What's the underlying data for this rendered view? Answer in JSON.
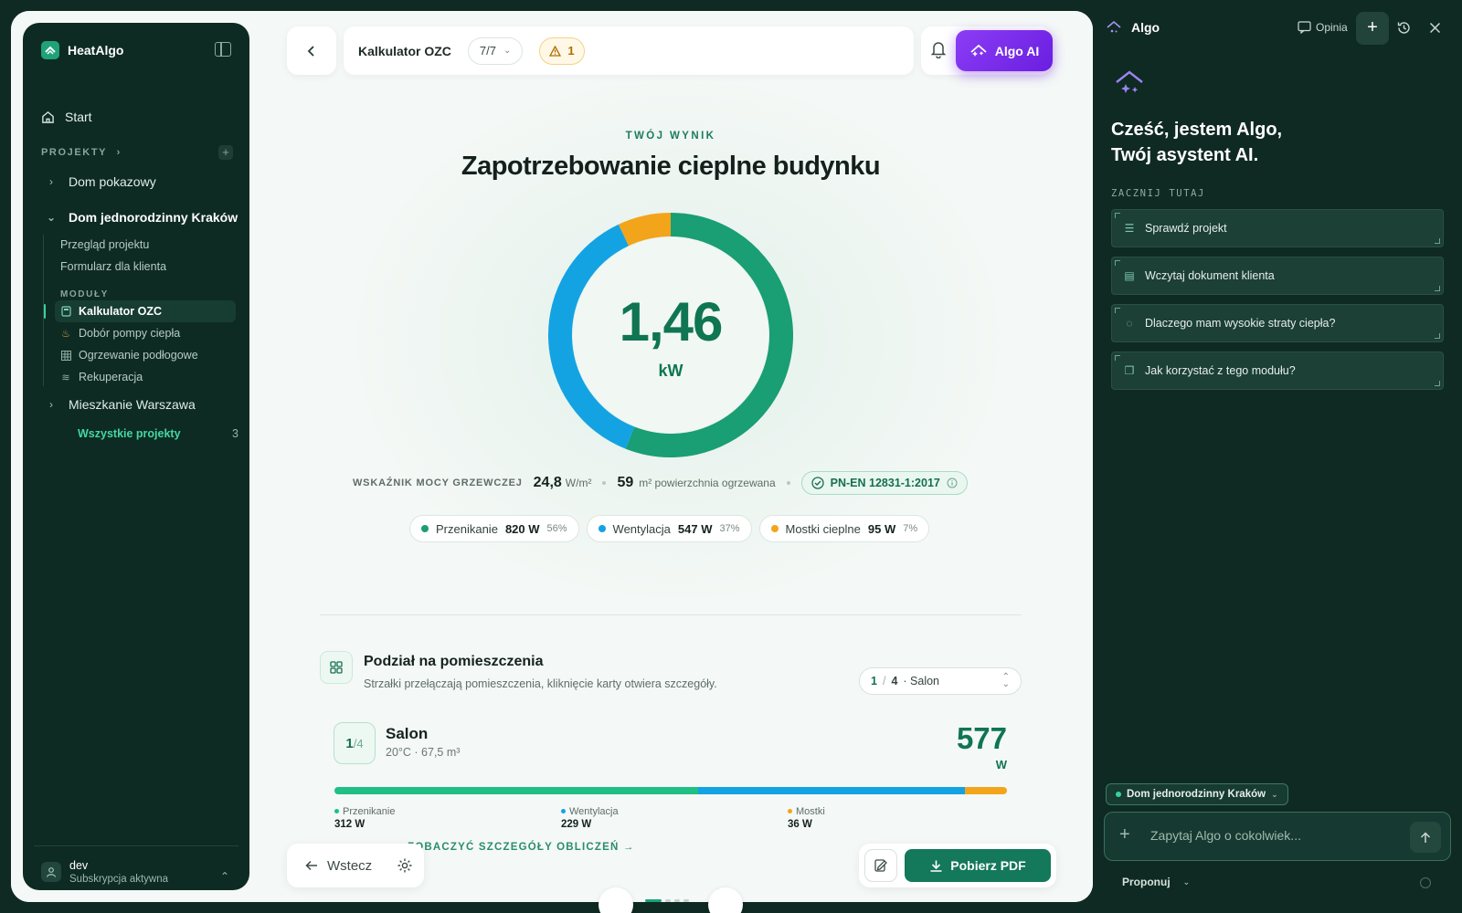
{
  "colors": {
    "primary_green": "#1a9e74",
    "blue": "#13a3e3",
    "orange": "#f2a51a",
    "dark_sidebar": "#0d2b23",
    "accent_purple": "#7b2ff0"
  },
  "sidebar": {
    "app_name": "HeatAlgo",
    "start_label": "Start",
    "projects_label": "PROJEKTY",
    "projects": [
      {
        "name": "Dom pokazowy",
        "expanded": false
      },
      {
        "name": "Dom jednorodzinny Kraków",
        "expanded": true
      },
      {
        "name": "Mieszkanie Warszawa",
        "expanded": false
      }
    ],
    "sub_items": [
      "Przegląd projektu",
      "Formularz dla klienta"
    ],
    "modules_label": "MODUŁY",
    "modules": [
      {
        "label": "Kalkulator OZC",
        "icon": "calculator-icon",
        "active": true
      },
      {
        "label": "Dobór pompy ciepła",
        "icon": "flame-icon",
        "active": false
      },
      {
        "label": "Ogrzewanie podłogowe",
        "icon": "grid-icon",
        "active": false
      },
      {
        "label": "Rekuperacja",
        "icon": "wind-icon",
        "active": false
      }
    ],
    "all_projects_label": "Wszystkie projekty",
    "all_projects_count": "3",
    "user_name": "dev",
    "user_status": "Subskrypcja aktywna"
  },
  "topbar": {
    "title": "Kalkulator OZC",
    "step": "7/7",
    "warnings": "1",
    "ai_button": "Algo AI"
  },
  "result": {
    "eyebrow": "TWÓJ WYNIK",
    "title": "Zapotrzebowanie cieplne budynku",
    "value": "1,46",
    "unit": "kW",
    "indicator_label": "WSKAŹNIK MOCY GRZEWCZEJ",
    "indicator_value": "24,8",
    "indicator_unit": "W/m²",
    "area_value": "59",
    "area_label": "m² powierzchnia ogrzewana",
    "norm": "PN-EN 12831-1:2017",
    "breakdown": [
      {
        "label": "Przenikanie",
        "watts": "820 W",
        "percent": "56%",
        "share": 56,
        "color": "#1a9e74"
      },
      {
        "label": "Wentylacja",
        "watts": "547 W",
        "percent": "37%",
        "share": 37,
        "color": "#13a3e3"
      },
      {
        "label": "Mostki cieplne",
        "watts": "95 W",
        "percent": "7%",
        "share": 7,
        "color": "#f2a51a"
      }
    ]
  },
  "rooms": {
    "title": "Podział na pomieszczenia",
    "subtitle": "Strzałki przełączają pomieszczenia, kliknięcie karty otwiera szczegóły.",
    "select_index": "1",
    "select_sep": "/",
    "select_total": "4",
    "select_name": "· Salon",
    "card": {
      "index": "1",
      "total": "/4",
      "name": "Salon",
      "meta": "20°C · 67,5 m³",
      "watts": "577",
      "unit": "W",
      "parts": [
        {
          "label": "Przenikanie",
          "value": "312 W",
          "watts": 312,
          "color": "#1fbf86"
        },
        {
          "label": "Wentylacja",
          "value": "229 W",
          "watts": 229,
          "color": "#13a3e3"
        },
        {
          "label": "Mostki",
          "value": "36 W",
          "watts": 36,
          "color": "#f2a51a"
        }
      ]
    },
    "details_link": "ZOBACZYĆ SZCZEGÓŁY OBLICZEŃ →"
  },
  "footer": {
    "back_label": "Wstecz",
    "pdf_label": "Pobierz PDF"
  },
  "assistant": {
    "title": "Algo",
    "feedback_label": "Opinia",
    "greeting_line1": "Cześć, jestem Algo,",
    "greeting_line2": "Twój asystent AI.",
    "start_label": "ZACZNIJ TUTAJ",
    "suggestions": [
      {
        "label": "Sprawdź projekt",
        "icon": "checklist-icon"
      },
      {
        "label": "Wczytaj dokument klienta",
        "icon": "file-plus-icon"
      },
      {
        "label": "Dlaczego mam wysokie straty ciepła?",
        "icon": "chat-question-icon"
      },
      {
        "label": "Jak korzystać z tego modułu?",
        "icon": "book-icon"
      }
    ],
    "context_project": "Dom jednorodzinny Kraków",
    "input_placeholder": "Zapytaj Algo o cokolwiek...",
    "mode_label": "Proponuj"
  }
}
